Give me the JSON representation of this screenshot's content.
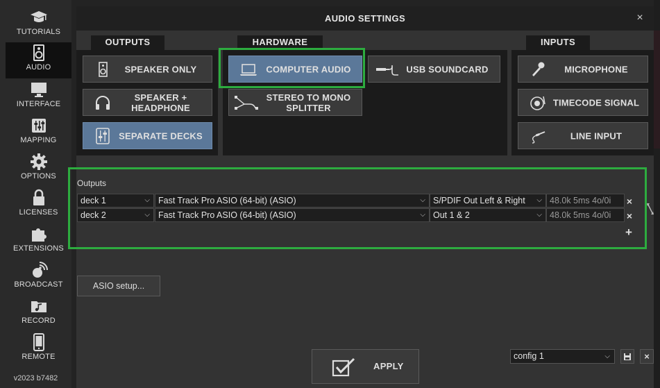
{
  "sidebar": {
    "items": [
      {
        "label": "TUTORIALS",
        "icon": "graduation-cap-icon"
      },
      {
        "label": "AUDIO",
        "icon": "speaker-icon",
        "active": true
      },
      {
        "label": "INTERFACE",
        "icon": "monitor-icon"
      },
      {
        "label": "MAPPING",
        "icon": "sliders-icon"
      },
      {
        "label": "OPTIONS",
        "icon": "gear-icon"
      },
      {
        "label": "LICENSES",
        "icon": "lock-icon"
      },
      {
        "label": "EXTENSIONS",
        "icon": "puzzle-icon"
      },
      {
        "label": "BROADCAST",
        "icon": "broadcast-icon"
      },
      {
        "label": "RECORD",
        "icon": "music-folder-icon"
      },
      {
        "label": "REMOTE",
        "icon": "phone-icon"
      }
    ],
    "version": "v2023 b7482"
  },
  "dialog": {
    "title": "AUDIO SETTINGS",
    "close": "×"
  },
  "groups": {
    "outputs": {
      "label": "OUTPUTS",
      "buttons": [
        {
          "label": "SPEAKER ONLY",
          "icon": "speaker-icon"
        },
        {
          "label": "SPEAKER + HEADPHONE",
          "icon": "headphones-icon"
        },
        {
          "label": "SEPARATE DECKS",
          "icon": "mixer-icon",
          "selected": true
        }
      ]
    },
    "hardware": {
      "label": "HARDWARE",
      "buttons": [
        {
          "label": "COMPUTER AUDIO",
          "icon": "laptop-icon",
          "selected": true
        },
        {
          "label": "USB SOUNDCARD",
          "icon": "usb-cable-icon"
        },
        {
          "label": "STEREO TO MONO SPLITTER",
          "icon": "splitter-cable-icon"
        }
      ]
    },
    "inputs": {
      "label": "INPUTS",
      "buttons": [
        {
          "label": "MICROPHONE",
          "icon": "microphone-icon"
        },
        {
          "label": "TIMECODE SIGNAL",
          "icon": "turntable-icon"
        },
        {
          "label": "LINE INPUT",
          "icon": "rca-cable-icon"
        }
      ]
    }
  },
  "outputs_table": {
    "label": "Outputs",
    "rows": [
      {
        "deck": "deck 1",
        "device": "Fast Track Pro ASIO (64-bit) (ASIO)",
        "channel": "S/PDIF Out Left & Right",
        "info": "48.0k 5ms 4o/0i"
      },
      {
        "deck": "deck 2",
        "device": "Fast Track Pro ASIO (64-bit) (ASIO)",
        "channel": "Out 1 & 2",
        "info": "48.0k 5ms 4o/0i"
      }
    ],
    "remove": "×",
    "add": "+"
  },
  "asio_setup": "ASIO setup...",
  "apply": "APPLY",
  "config": {
    "value": "config 1",
    "delete": "×"
  },
  "colors": {
    "selected": "#5b7899",
    "highlight": "#2dac3f",
    "panel": "#333333",
    "group": "#1b1b1b"
  }
}
